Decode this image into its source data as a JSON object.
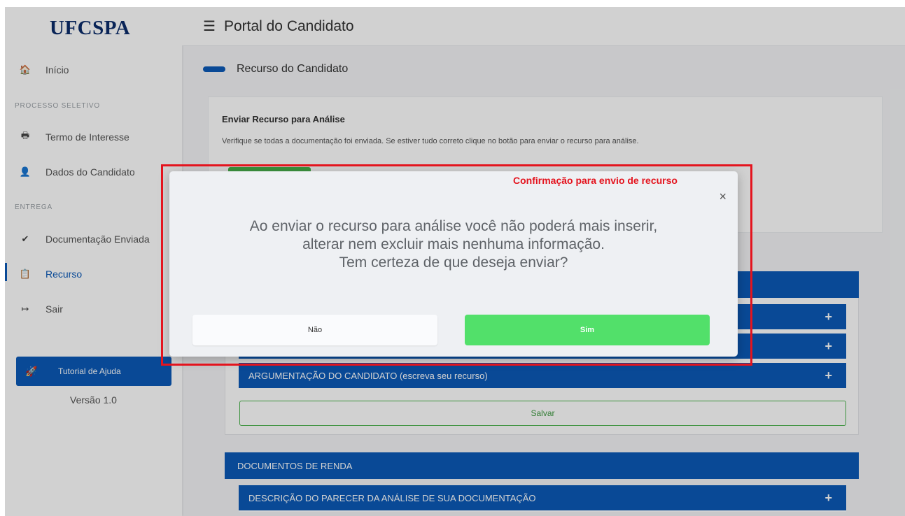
{
  "sidebar": {
    "logo": "UFCSPA",
    "items": [
      {
        "label": "Início",
        "icon": "home-icon",
        "glyph": "🏠"
      },
      {
        "label": "Termo de Interesse",
        "icon": "printer-icon",
        "glyph": "🖶"
      },
      {
        "label": "Dados do Candidato",
        "icon": "user-icon",
        "glyph": "👤"
      },
      {
        "label": "Documentação Enviada",
        "icon": "check-icon",
        "glyph": "✔"
      },
      {
        "label": "Recurso",
        "icon": "clipboard-icon",
        "glyph": "📋"
      },
      {
        "label": "Sair",
        "icon": "sign-out-icon",
        "glyph": "↦"
      }
    ],
    "sections": [
      "PROCESSO SELETIVO",
      "ENTREGA"
    ],
    "help_button": "Tutorial de Ajuda",
    "version": "Versão 1.0"
  },
  "topbar": {
    "title": "Portal do Candidato"
  },
  "main": {
    "section_title": "Recurso do Candidato",
    "card1": {
      "title": "Enviar Recurso para Análise",
      "text": "Verifique se todas a documentação foi enviada. Se estiver tudo correto clique no botão para enviar o recurso para análise."
    },
    "accordion": {
      "argumentacao": "ARGUMENTAÇÃO DO CANDIDATO (escreva seu recurso)",
      "save_label": "Salvar"
    },
    "documentos_renda": {
      "header": "DOCUMENTOS DE RENDA",
      "item1": "DESCRIÇÃO DO PARECER DA ANÁLISE DE SUA DOCUMENTAÇÃO"
    }
  },
  "modal": {
    "line1": "Ao enviar o recurso para análise você não poderá mais inserir,",
    "line2": "alterar nem excluir mais nenhuma informação.",
    "line3": "Tem certeza de que deseja enviar?",
    "no_label": "Não",
    "yes_label": "Sim",
    "close_glyph": "×"
  },
  "annotation": {
    "label": "Confirmação para envio de recurso",
    "color": "#e4141e"
  },
  "colors": {
    "primary": "#0b5ab8",
    "success": "#52e06a",
    "logo": "#0b2c6b"
  }
}
